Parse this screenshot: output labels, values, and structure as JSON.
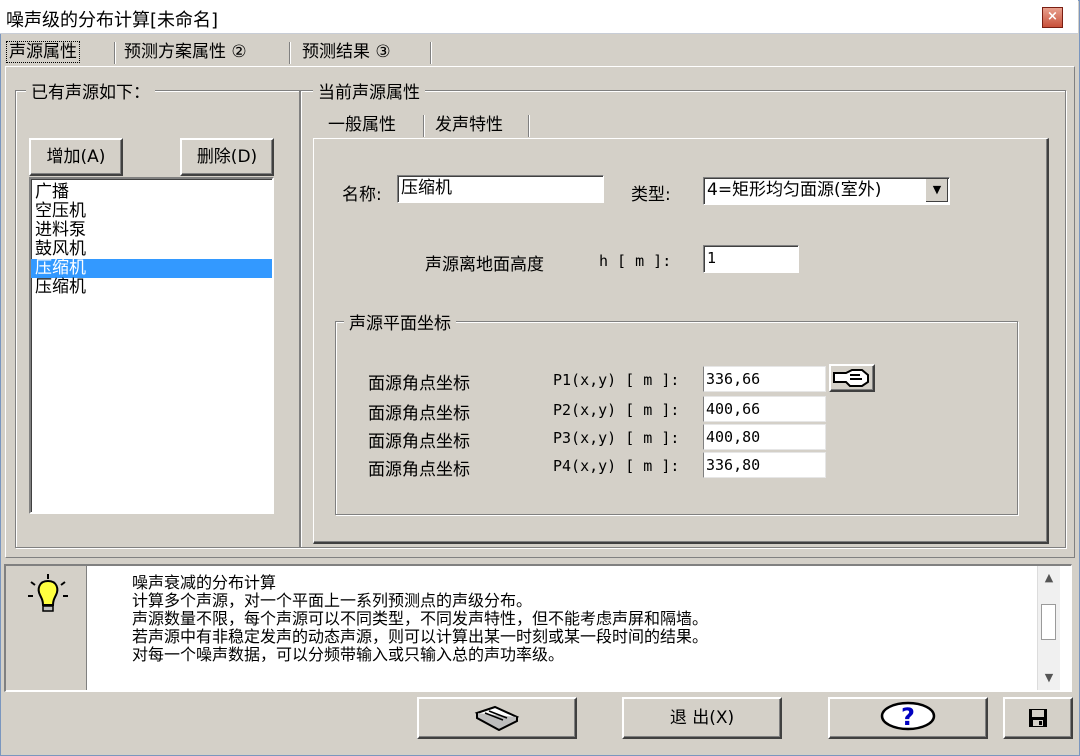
{
  "window": {
    "title": "噪声级的分布计算[未命名]",
    "close_symbol": "×"
  },
  "tabs": [
    {
      "label": "声源属性"
    },
    {
      "label": "预测方案属性 ②"
    },
    {
      "label": "预测结果 ③"
    }
  ],
  "sources": {
    "legend": "已有声源如下：",
    "add_label": "增加(A)",
    "delete_label": "删除(D)",
    "items": [
      "广播",
      "空压机",
      "进料泵",
      "鼓风机",
      "压缩机",
      "压缩机"
    ],
    "selected_index": 4
  },
  "current": {
    "legend": "当前声源属性",
    "subtabs": [
      {
        "label": "一般属性"
      },
      {
        "label": "发声特性"
      }
    ],
    "name_label": "名称:",
    "name_value": "压缩机",
    "type_label": "类型:",
    "type_value": "4=矩形均匀面源(室外)",
    "height_label": "声源离地面高度",
    "height_unit": "h [ m ]:",
    "height_value": "1",
    "coord_legend": "声源平面坐标",
    "corners": [
      {
        "label": "面源角点坐标",
        "key": "P1(x,y) [ m ]:",
        "value": "336,66"
      },
      {
        "label": "面源角点坐标",
        "key": "P2(x,y) [ m ]:",
        "value": "400,66"
      },
      {
        "label": "面源角点坐标",
        "key": "P3(x,y) [ m ]:",
        "value": "400,80"
      },
      {
        "label": "面源角点坐标",
        "key": "P4(x,y) [ m ]:",
        "value": "336,80"
      }
    ]
  },
  "help": {
    "lines": [
      "噪声衰减的分布计算",
      "计算多个声源，对一个平面上一系列预测点的声级分布。",
      "声源数量不限，每个声源可以不同类型，不同发声特性，但不能考虑声屏和隔墙。",
      "若声源中有非稳定发声的动态声源，则可以计算出某一时刻或某一段时间的结果。",
      "对每一个噪声数据，可以分频带输入或只输入总的声功率级。"
    ]
  },
  "footer": {
    "exit_label": "退 出(X)",
    "help_symbol": "?"
  },
  "icons": [
    "lightbulb-icon",
    "book-icon",
    "help-icon",
    "save-icon",
    "pick-hand-icon",
    "dropdown-arrow-icon"
  ]
}
